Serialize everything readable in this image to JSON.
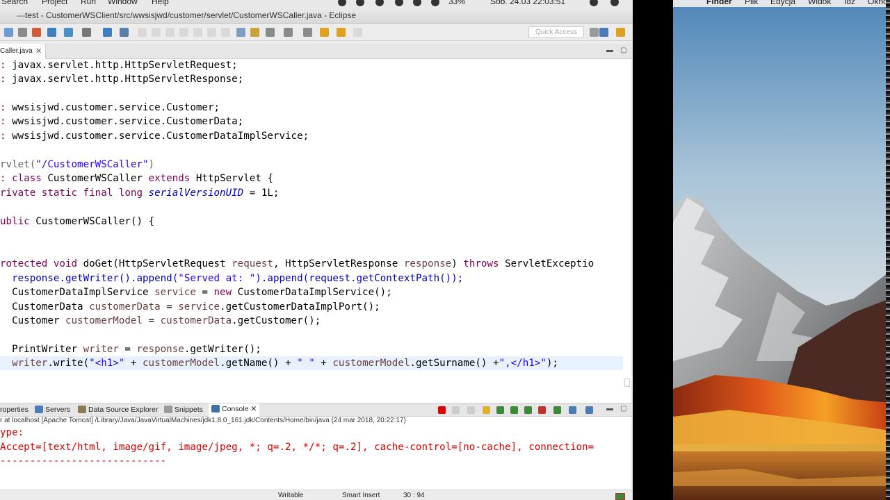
{
  "system_menubar": {
    "items": [
      "Search",
      "Project",
      "Run",
      "Window",
      "Help"
    ],
    "battery": "33%",
    "clock": "Sob. 24.03  22:03:51"
  },
  "window": {
    "title": "test - CustomerWSClient/src/wwsisjwd/customer/servlet/CustomerWSCaller.java - Eclipse"
  },
  "toolbar": {
    "quick_access_placeholder": "Quick Access"
  },
  "editor": {
    "tab_label": "Caller.java",
    "line_highlight_color": "#e8f2fe",
    "keyword_color": "#7f0055",
    "string_color": "#2a00ff",
    "field_color": "#0000c0"
  },
  "code": {
    "l1a": ": ",
    "l1b": "javax.servlet.http.HttpServletRequest;",
    "l2a": ": ",
    "l2b": "javax.servlet.http.HttpServletResponse;",
    "l4a": ": ",
    "l4b": "wwsisjwd.customer.service.Customer;",
    "l5a": ": ",
    "l5b": "wwsisjwd.customer.service.CustomerData;",
    "l6a": ": ",
    "l6b": "wwsisjwd.customer.service.CustomerDataImplService;",
    "l8a": "rvlet(",
    "l8b": "\"/CustomerWSCaller\"",
    "l8c": ")",
    "l9a": ": ",
    "l9b": "class",
    "l9c": " CustomerWSCaller ",
    "l9d": "extends",
    "l9e": " HttpServlet {",
    "l10a": "rivate static final long",
    "l10b": " ",
    "l10c": "serialVersionUID",
    "l10d": " = 1L;",
    "l12a": "ublic",
    "l12b": " CustomerWSCaller() {",
    "l15a": "rotected void",
    "l15b": " doGet(HttpServletRequest ",
    "l15c": "request",
    "l15d": ", HttpServletResponse ",
    "l15e": "response",
    "l15f": ") ",
    "l15g": "throws",
    "l15h": " ServletExceptio",
    "l16a": "  ",
    "l16b": "response",
    "l16c": ".getWriter().append(",
    "l16d": "\"Served at: \"",
    "l16e": ").append(",
    "l16f": "request",
    "l16g": ".getContextPath());",
    "l17a": "  CustomerDataImplService ",
    "l17b": "service",
    "l17c": " = ",
    "l17d": "new",
    "l17e": " CustomerDataImplService();",
    "l18a": "  CustomerData ",
    "l18b": "customerData",
    "l18c": " = ",
    "l18d": "service",
    "l18e": ".getCustomerDataImplPort();",
    "l19a": "  Customer ",
    "l19b": "customerModel",
    "l19c": " = ",
    "l19d": "customerData",
    "l19e": ".getCustomer();",
    "l21a": "  PrintWriter ",
    "l21b": "writer",
    "l21c": " = ",
    "l21d": "response",
    "l21e": ".getWriter();",
    "l22a": "  ",
    "l22b": "writer",
    "l22c": ".write(",
    "l22d": "\"<h1>\"",
    "l22e": " + ",
    "l22f": "customerModel",
    "l22g": ".getName() + ",
    "l22h": "\" \"",
    "l22i": " + ",
    "l22j": "customerModel",
    "l22k": ".getSurname() +",
    "l22l": "\",</h1>\"",
    "l22m": ");"
  },
  "bottom_panel": {
    "tabs": [
      "roperties",
      "Servers",
      "Data Source Explorer",
      "Snippets",
      "Console"
    ],
    "console_header": "r at localhost [Apache Tomcat] /Library/Java/JavaVirtualMachines/jdk1.8.0_161.jdk/Contents/Home/bin/java (24 mar 2018, 20:22:17)",
    "lines": [
      "ype:",
      "Accept=[text/html, image/gif, image/jpeg, *; q=.2, */*; q=.2], cache-control=[no-cache], connection=",
      "----------------------------"
    ]
  },
  "status_bar": {
    "mode": "Writable",
    "insert": "Smart Insert",
    "position": "30 : 94"
  },
  "desktop_menubar": {
    "items": [
      "Finder",
      "Plik",
      "Edycja",
      "Widok",
      "Idź",
      "Okno"
    ]
  }
}
